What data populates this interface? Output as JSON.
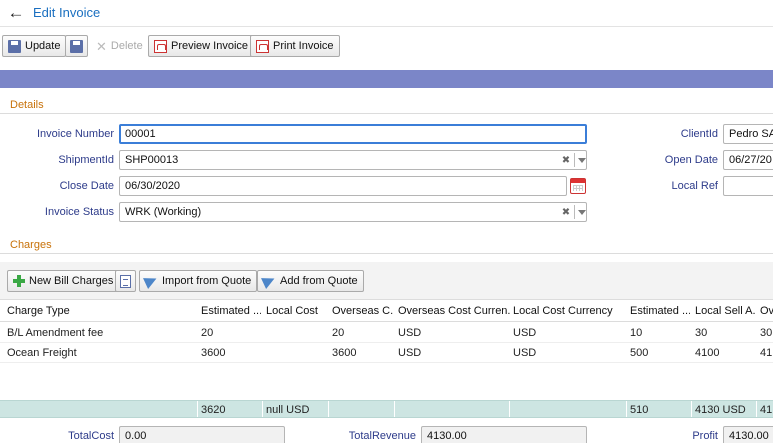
{
  "header": {
    "title": "Edit Invoice",
    "back_icon": "arrow-left-icon"
  },
  "toolbar": {
    "update_label": "Update",
    "delete_label": "Delete",
    "preview_label": "Preview Invoice",
    "print_label": "Print Invoice"
  },
  "details": {
    "section_title": "Details",
    "invoice_number": {
      "label": "Invoice Number",
      "value": "00001"
    },
    "shipment_id": {
      "label": "ShipmentId",
      "value": "SHP00013"
    },
    "close_date": {
      "label": "Close Date",
      "value": "06/30/2020"
    },
    "invoice_status": {
      "label": "Invoice Status",
      "value": "WRK (Working)"
    },
    "client_id": {
      "label": "ClientId",
      "value": "Pedro SA"
    },
    "open_date": {
      "label": "Open Date",
      "value": "06/27/20"
    },
    "local_ref": {
      "label": "Local Ref",
      "value": ""
    }
  },
  "charges": {
    "section_title": "Charges",
    "new_bill_label": "New Bill Charges",
    "import_label": "Import from Quote",
    "add_label": "Add from Quote",
    "columns": [
      "Charge Type",
      "Estimated ...",
      "Local Cost",
      "Overseas C...",
      "Overseas Cost Curren...",
      "Local Cost Currency",
      "Estimated ...",
      "Local Sell A...",
      "Ov"
    ],
    "rows": [
      [
        "B/L Amendment fee",
        "20",
        "",
        "20",
        "USD",
        "USD",
        "10",
        "30",
        "30"
      ],
      [
        "Ocean Freight",
        "3600",
        "",
        "3600",
        "USD",
        "USD",
        "500",
        "4100",
        "41"
      ]
    ],
    "summary": [
      "",
      "3620",
      "null USD",
      "",
      "",
      "",
      "510",
      "4130 USD",
      "41"
    ]
  },
  "totals": {
    "total_cost": {
      "label": "TotalCost",
      "value": "0.00"
    },
    "total_revenue": {
      "label": "TotalRevenue",
      "value": "4130.00"
    },
    "profit": {
      "label": "Profit",
      "value": "4130.00"
    }
  },
  "colors": {
    "accent": "#1a6fc0",
    "banner": "#7b86c8",
    "section": "#c8720a",
    "label": "#2d3b8a",
    "summary": "#cde5e2"
  }
}
